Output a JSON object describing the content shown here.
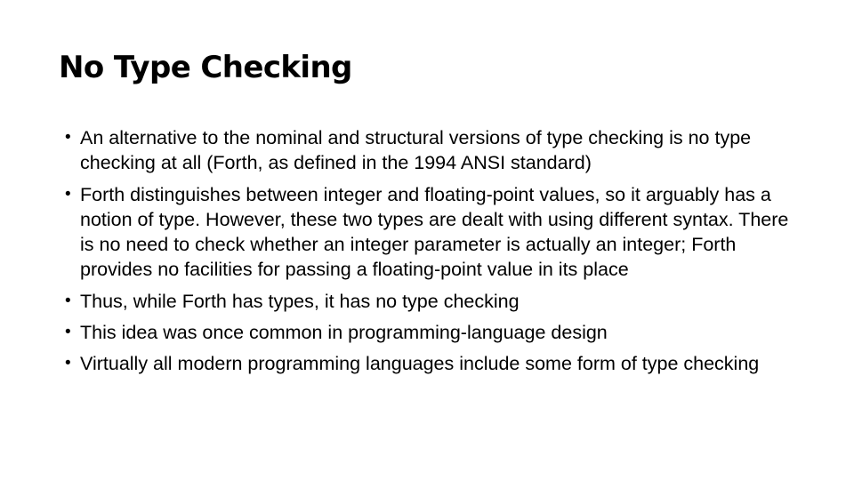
{
  "slide": {
    "title": "No Type Checking",
    "background_color": "#ffffff",
    "text_color": "#000000",
    "bullet_glyph": "•",
    "bullets": [
      {
        "marker": "•",
        "text": "An alternative to the nominal and structural versions of type checking is no type checking at all (Forth, as defined in the 1994 ANSI standard)"
      },
      {
        "marker": "•",
        "text": "Forth distinguishes between integer and floating-point values, so it arguably has a notion of type. However, these two types are dealt with using different syntax. There is no need to check whether an integer parameter is actually an integer; Forth provides no facilities for passing a floating-point value in its place"
      },
      {
        "marker": "•",
        "text": "Thus, while Forth has types, it has no type checking"
      },
      {
        "marker": "•",
        "text": "This idea was once common in programming-language design"
      },
      {
        "marker": "•",
        "text": "Virtually all modern programming languages include some form of type checking"
      }
    ]
  }
}
